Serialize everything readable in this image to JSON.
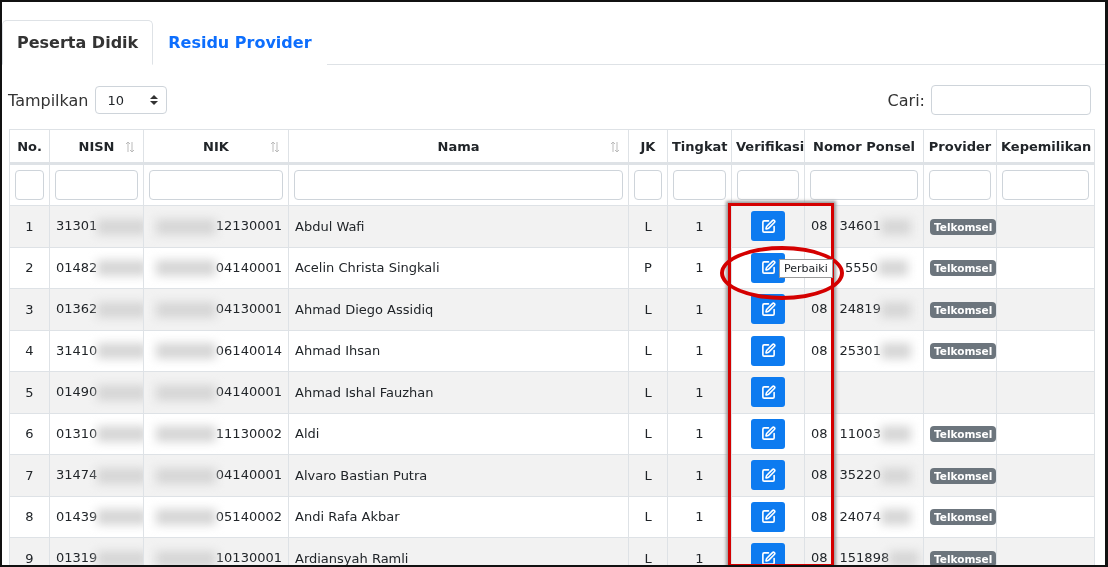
{
  "tabs": [
    {
      "label": "Peserta Didik",
      "selected": true
    },
    {
      "label": "Residu Provider",
      "selected": false
    }
  ],
  "length_control": {
    "label": "Tampilkan",
    "value": "10"
  },
  "search": {
    "label": "Cari:"
  },
  "table": {
    "columns": [
      {
        "label": "No.",
        "sortable": false
      },
      {
        "label": "NISN",
        "sortable": true
      },
      {
        "label": "NIK",
        "sortable": true
      },
      {
        "label": "Nama",
        "sortable": true
      },
      {
        "label": "JK",
        "sortable": false
      },
      {
        "label": "Tingkat",
        "sortable": false
      },
      {
        "label": "Verifikasi",
        "sortable": false
      },
      {
        "label": "Nomor Ponsel",
        "sortable": false
      },
      {
        "label": "Provider",
        "sortable": false
      },
      {
        "label": "Kepemilikan",
        "sortable": false
      }
    ],
    "rows": [
      {
        "no": "1",
        "nisn": "31301",
        "nik": "12130001",
        "nama": "Abdul Wafi",
        "jk": "L",
        "tingkat": "1",
        "phone_prefix": "08",
        "phone": "34601",
        "provider": "Telkomsel"
      },
      {
        "no": "2",
        "nisn": "01482",
        "nik": "04140001",
        "nama": "Acelin Christa Singkali",
        "jk": "P",
        "tingkat": "1",
        "phone": "5550",
        "provider": "Telkomsel"
      },
      {
        "no": "3",
        "nisn": "01362",
        "nik": "04130001",
        "nama": "Ahmad Diego Assidiq",
        "jk": "L",
        "tingkat": "1",
        "phone_prefix": "08",
        "phone": "24819",
        "provider": "Telkomsel"
      },
      {
        "no": "4",
        "nisn": "31410",
        "nik": "06140014",
        "nama": "Ahmad Ihsan",
        "jk": "L",
        "tingkat": "1",
        "phone_prefix": "08",
        "phone": "25301",
        "provider": "Telkomsel"
      },
      {
        "no": "5",
        "nisn": "01490",
        "nik": "04140001",
        "nama": "Ahmad Ishal Fauzhan",
        "jk": "L",
        "tingkat": "1"
      },
      {
        "no": "6",
        "nisn": "01310",
        "nik": "11130002",
        "nama": "Aldi",
        "jk": "L",
        "tingkat": "1",
        "phone_prefix": "08",
        "phone": "11003",
        "provider": "Telkomsel"
      },
      {
        "no": "7",
        "nisn": "31474",
        "nik": "04140001",
        "nama": "Alvaro Bastian Putra",
        "jk": "L",
        "tingkat": "1",
        "phone_prefix": "08",
        "phone": "35220",
        "provider": "Telkomsel"
      },
      {
        "no": "8",
        "nisn": "01439",
        "nik": "05140002",
        "nama": "Andi Rafa Akbar",
        "jk": "L",
        "tingkat": "1",
        "phone_prefix": "08",
        "phone": "24074",
        "provider": "Telkomsel"
      },
      {
        "no": "9",
        "nisn": "01319",
        "nik": "10130001",
        "nama": "Ardiansyah Ramli",
        "jk": "L",
        "tingkat": "1",
        "phone_prefix": "08",
        "phone": "151898",
        "provider": "Telkomsel"
      }
    ]
  },
  "tooltip": {
    "label": "Perbaiki"
  }
}
